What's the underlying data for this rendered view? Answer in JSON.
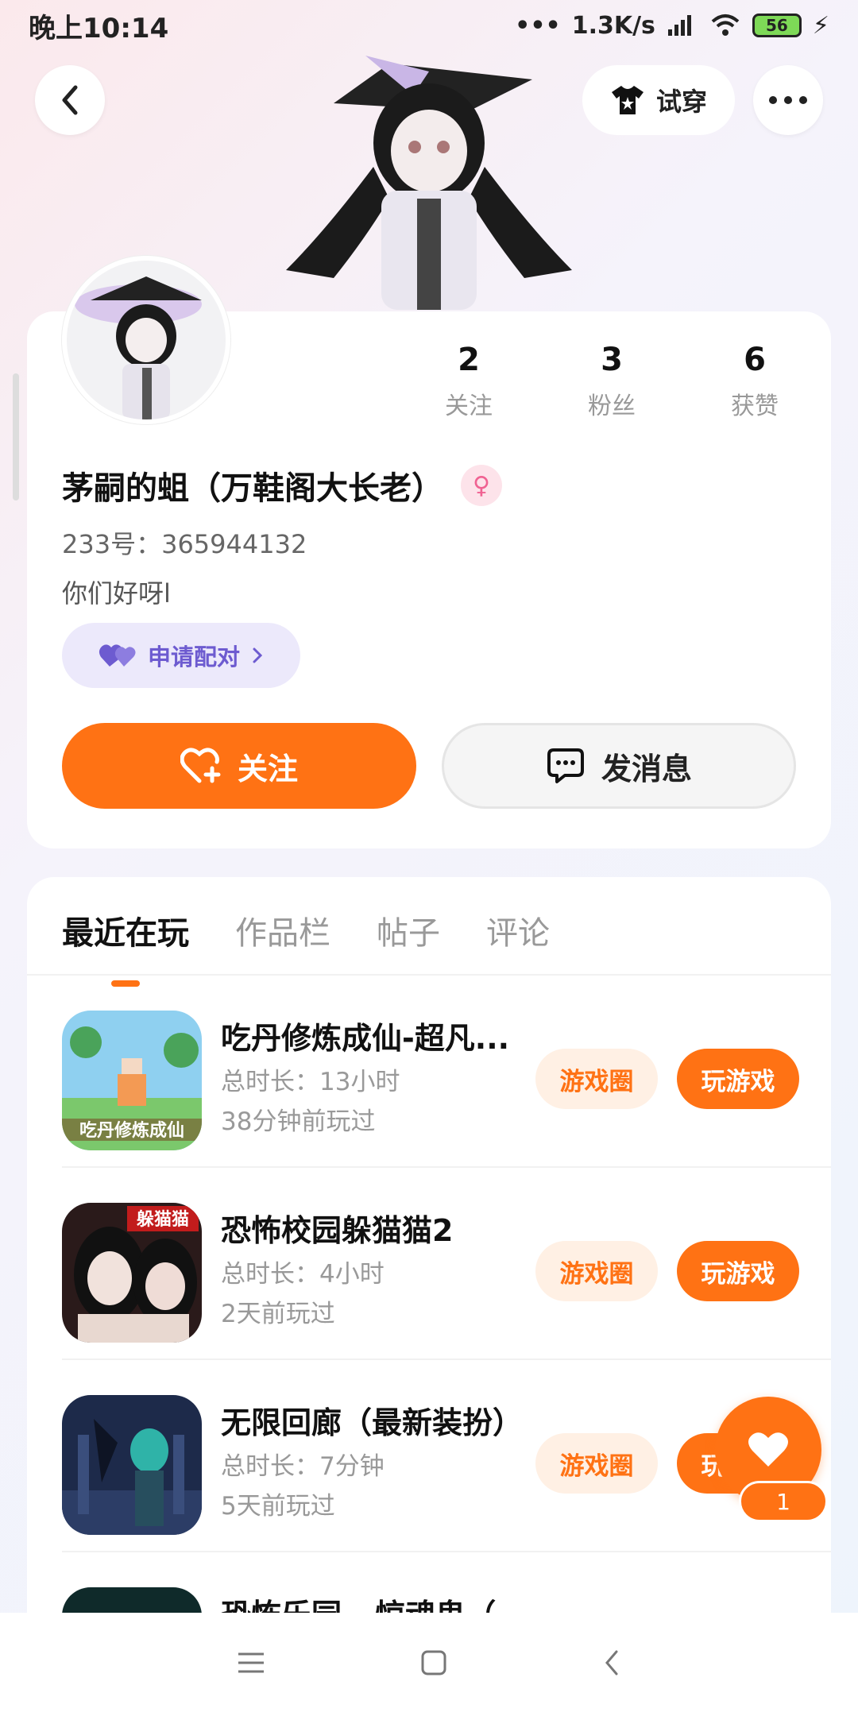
{
  "status_bar": {
    "time": "晚上10:14",
    "network": "1.3K/s",
    "battery": "56"
  },
  "header": {
    "try_on_label": "试穿"
  },
  "profile": {
    "name": "茅嗣的蛆（万鞋阁大长老）",
    "id_text": "233号：365944132",
    "bio": "你们好呀l",
    "pair_label": "申请配对",
    "stats": [
      {
        "num": "2",
        "label": "关注"
      },
      {
        "num": "3",
        "label": "粉丝"
      },
      {
        "num": "6",
        "label": "获赞"
      }
    ],
    "follow_label": "关注",
    "message_label": "发消息"
  },
  "tabs": [
    "最近在玩",
    "作品栏",
    "帖子",
    "评论"
  ],
  "games": [
    {
      "name": "吃丹修炼成仙-超凡...",
      "duration": "总时长：13小时",
      "last_played": "38分钟前玩过",
      "circle_label": "游戏圈",
      "play_label": "玩游戏"
    },
    {
      "name": "恐怖校园躲猫猫2",
      "duration": "总时长：4小时",
      "last_played": "2天前玩过",
      "circle_label": "游戏圈",
      "play_label": "玩游戏"
    },
    {
      "name": "无限回廊（最新装扮）",
      "duration": "总时长：7分钟",
      "last_played": "5天前玩过",
      "circle_label": "游戏圈",
      "play_label": "玩游戏"
    },
    {
      "name": "恐怖乐园 - 惊魂鬼（",
      "duration": "",
      "last_played": "",
      "circle_label": "",
      "play_label": ""
    }
  ],
  "fab": {
    "count": "1"
  },
  "thumb_labels": {
    "game1": "吃丹修炼成仙",
    "game2": "躲猫猫"
  },
  "colors": {
    "accent": "#ff7214",
    "pair_bg": "#ece9fb",
    "pair_text": "#6d5bd0"
  }
}
